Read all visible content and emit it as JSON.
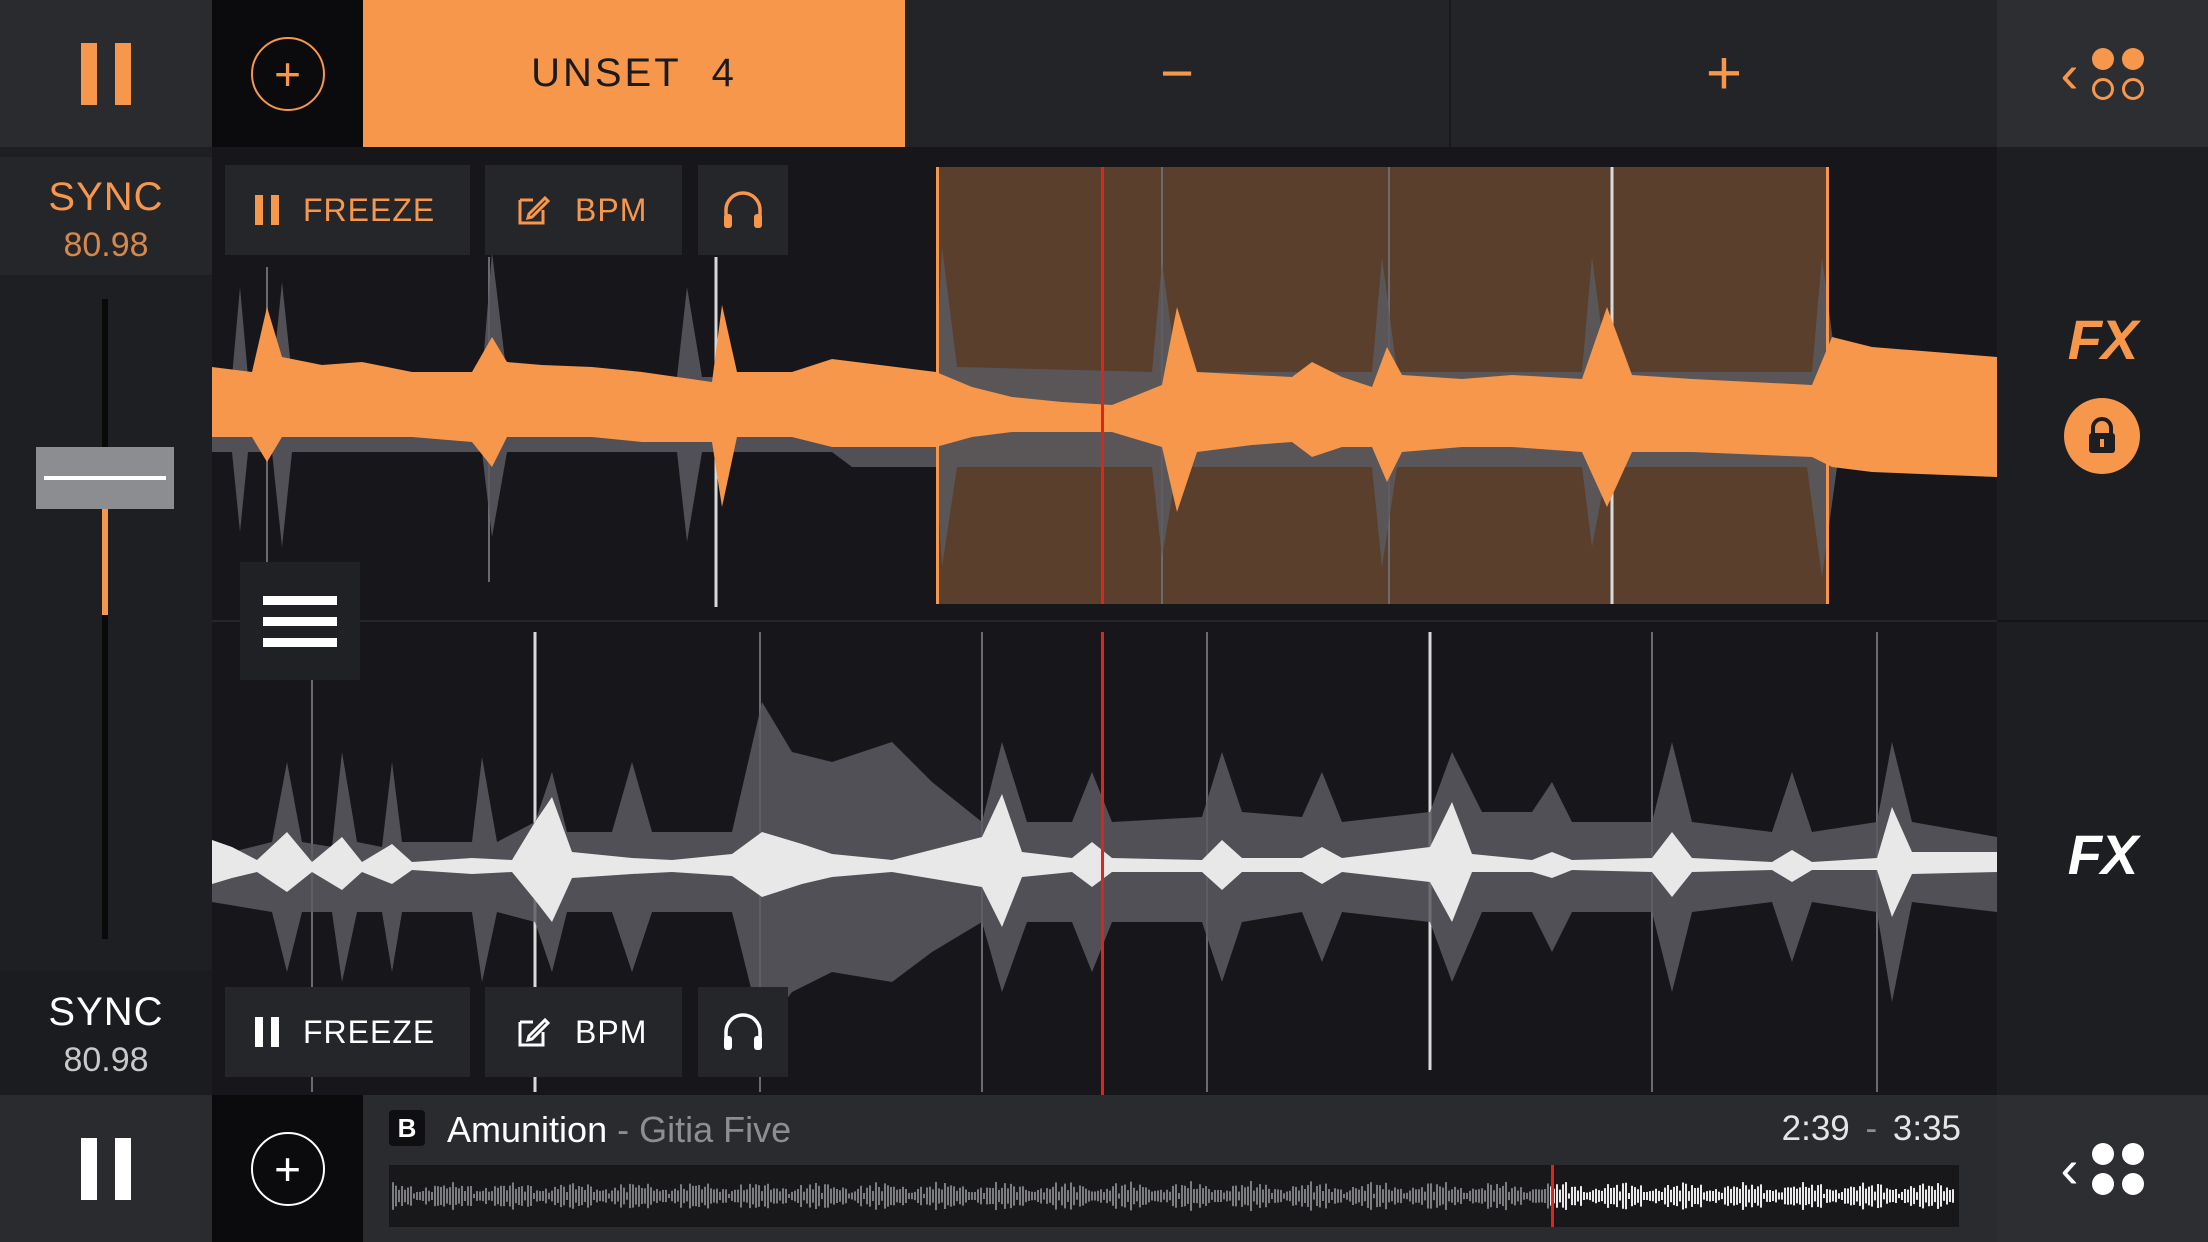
{
  "top_bar": {
    "loop_size_label": "UNSET",
    "loop_size_value": "4",
    "minus_label": "−",
    "plus_label": "+"
  },
  "deck_a": {
    "sync_label": "SYNC",
    "bpm": "80.98",
    "freeze_label": "FREEZE",
    "bpm_button_label": "BPM",
    "fx_label": "FX"
  },
  "deck_b": {
    "sync_label": "SYNC",
    "bpm": "80.98",
    "freeze_label": "FREEZE",
    "bpm_button_label": "BPM",
    "fx_label": "FX"
  },
  "now_playing": {
    "deck_letter": "B",
    "title": "Amunition",
    "separator": "-",
    "artist": "Gitia Five",
    "elapsed": "2:39",
    "time_separator": "-",
    "remaining": "3:35",
    "progress_fraction": 0.74
  },
  "colors": {
    "accent": "#f6974c",
    "loop_region": "#5a3f2c",
    "playhead": "#e0231c",
    "deck_b_wave": "#e8e8e8"
  },
  "icons": {
    "pause": "pause-icon",
    "add": "plus-circle-icon",
    "decks": "deck-grid-icon",
    "edit": "edit-icon",
    "headphones": "headphones-icon",
    "lock": "lock-icon",
    "menu": "hamburger-icon"
  }
}
